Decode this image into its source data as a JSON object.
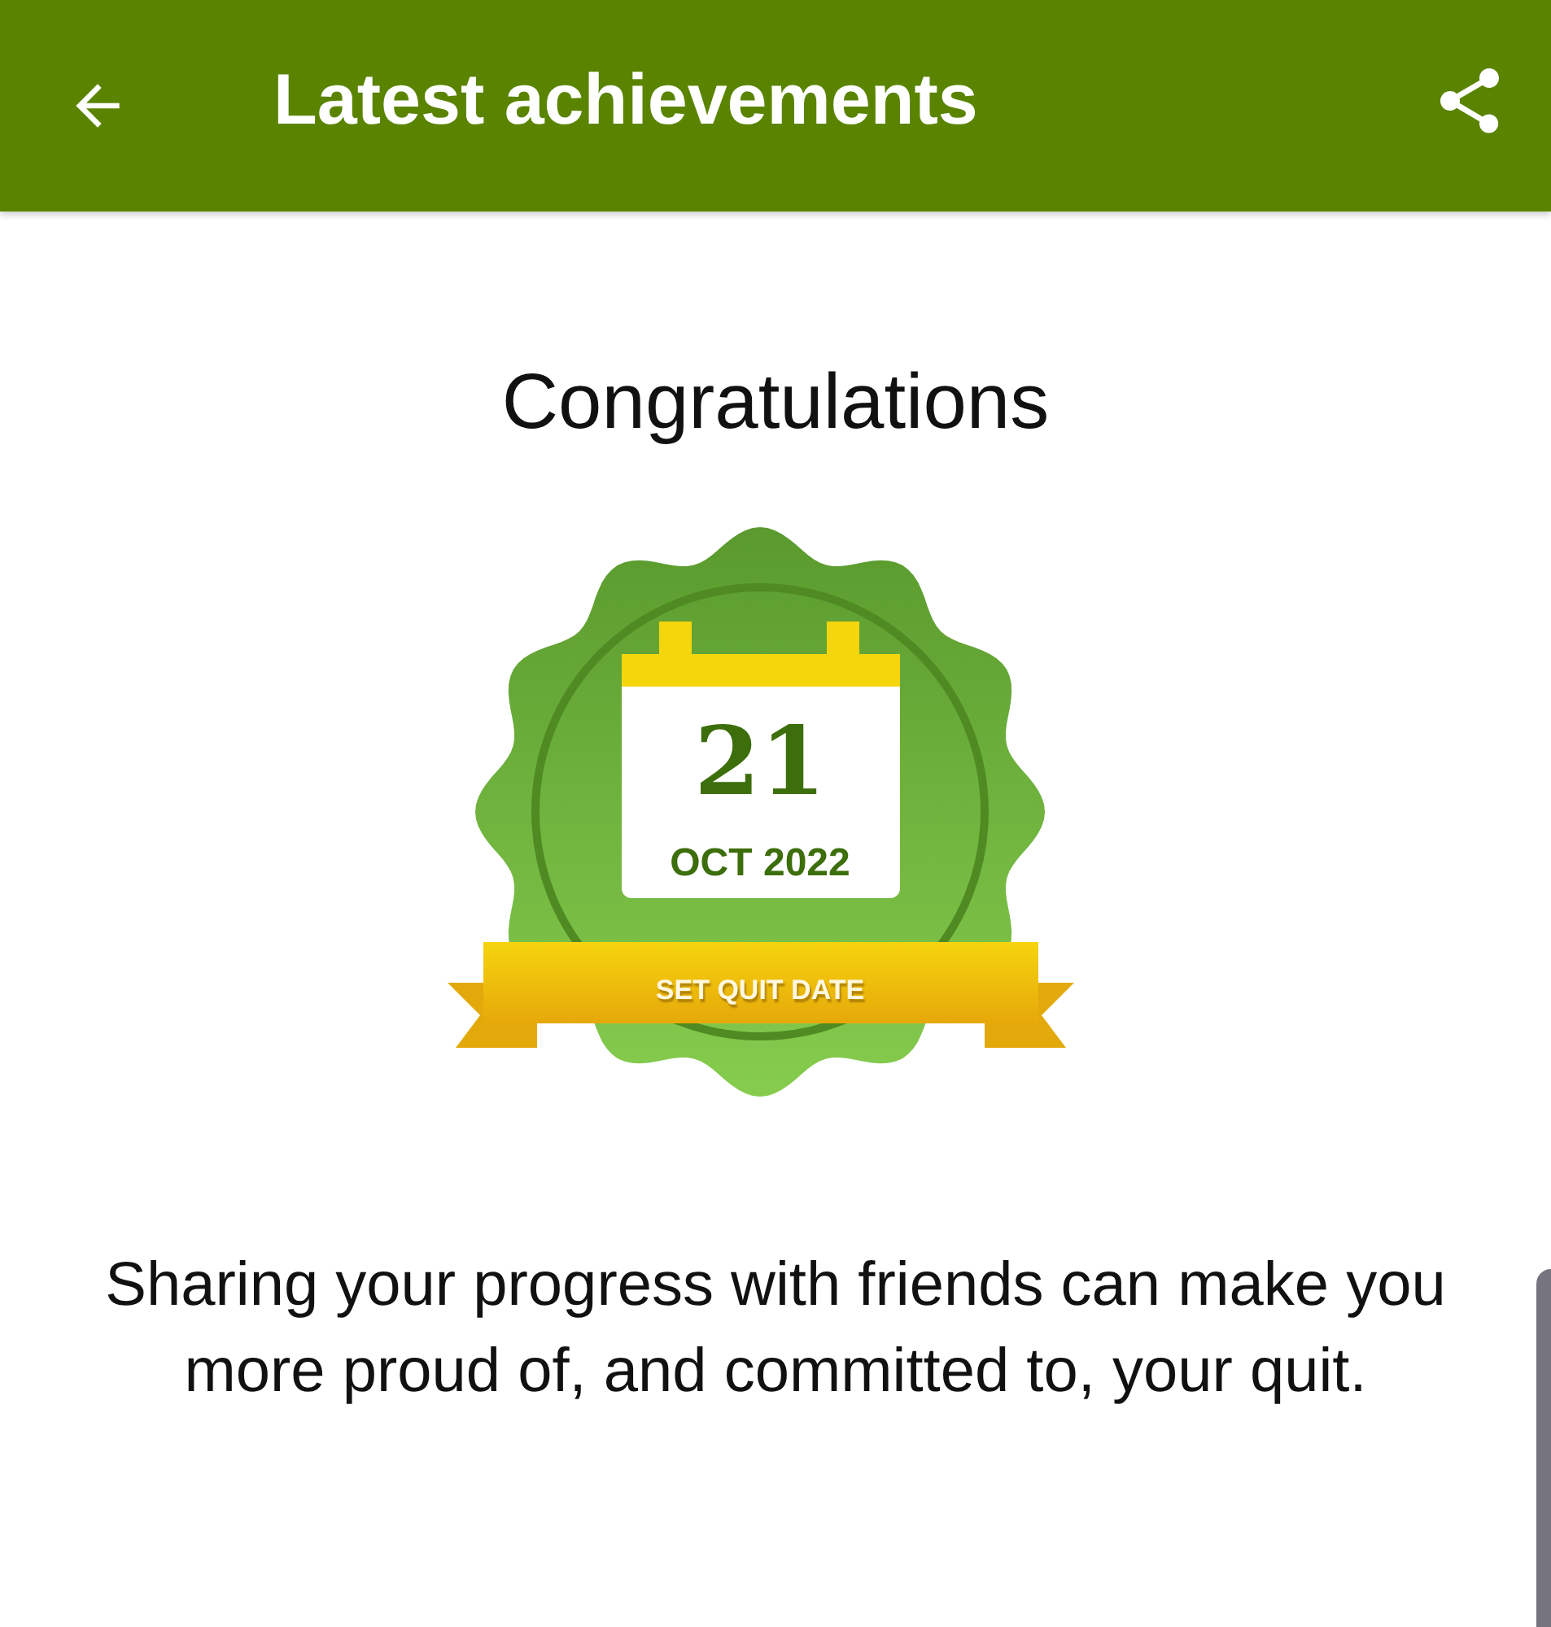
{
  "app_bar": {
    "title": "Latest achievements"
  },
  "heading": "Congratulations",
  "badge": {
    "day": "21",
    "month_year": "OCT 2022",
    "ribbon": "SET QUIT DATE"
  },
  "message": "Sharing your progress with friends can make you more proud of, and committed to, your quit."
}
